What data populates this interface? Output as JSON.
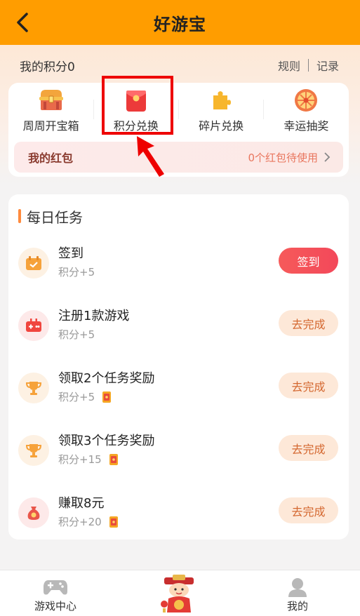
{
  "header": {
    "title": "好游宝"
  },
  "points": {
    "label": "我的积分0",
    "rules": "规则",
    "records": "记录"
  },
  "functions": [
    {
      "label": "周周开宝箱",
      "icon": "treasure-chest-icon"
    },
    {
      "label": "积分兑换",
      "icon": "red-envelope-icon"
    },
    {
      "label": "碎片兑换",
      "icon": "puzzle-piece-icon"
    },
    {
      "label": "幸运抽奖",
      "icon": "lucky-wheel-icon"
    }
  ],
  "redbag": {
    "title": "我的红包",
    "info": "0个红包待使用"
  },
  "tasks": {
    "title": "每日任务",
    "items": [
      {
        "name": "签到",
        "reward": "积分+5",
        "button": "签到",
        "coupon": false,
        "icon": "checkin-calendar-icon"
      },
      {
        "name": "注册1款游戏",
        "reward": "积分+5",
        "button": "去完成",
        "coupon": false,
        "icon": "gamepad-icon"
      },
      {
        "name": "领取2个任务奖励",
        "reward": "积分+5",
        "button": "去完成",
        "coupon": true,
        "icon": "trophy-icon"
      },
      {
        "name": "领取3个任务奖励",
        "reward": "积分+15",
        "button": "去完成",
        "coupon": true,
        "icon": "trophy-icon"
      },
      {
        "name": "赚取8元",
        "reward": "积分+20",
        "button": "去完成",
        "coupon": true,
        "icon": "money-bag-icon"
      }
    ]
  },
  "tabbar": {
    "left": "游戏中心",
    "right": "我的"
  },
  "colors": {
    "header": "#ff9d00",
    "primary_btn": "#f5505a",
    "secondary_btn_bg": "#fde8d8",
    "secondary_btn_text": "#d4672f",
    "highlight": "#ee0000"
  }
}
